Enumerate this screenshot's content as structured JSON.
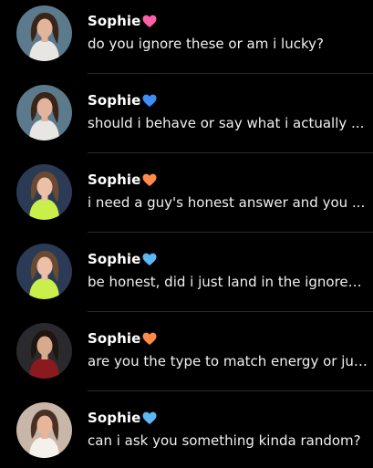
{
  "conversations": [
    {
      "name": "Sophie",
      "heart": "pink-heart-icon",
      "heart_color": "#ff5fa8",
      "preview": "do you ignore these or am i lucky?",
      "avatar_bg": "#5b7a8c",
      "hair": "#3a2418",
      "skin": "#e3b49c",
      "top": "#e8e6e2"
    },
    {
      "name": "Sophie",
      "heart": "blue-heart-icon",
      "heart_color": "#3d8ef7",
      "preview": "should i behave or say what i actually ...",
      "avatar_bg": "#5b7a8c",
      "hair": "#3a2418",
      "skin": "#e3b49c",
      "top": "#e8e6e2"
    },
    {
      "name": "Sophie",
      "heart": "orange-heart-icon",
      "heart_color": "#ff8a4c",
      "preview": "i need a guy's honest answer and you ...",
      "avatar_bg": "#2b3a55",
      "hair": "#6a4a30",
      "skin": "#eac0a6",
      "top": "#c9ef4a"
    },
    {
      "name": "Sophie",
      "heart": "light-blue-heart-icon",
      "heart_color": "#5cb8f5",
      "preview": "be honest, did i just land in the ignored ...",
      "avatar_bg": "#2b3a55",
      "hair": "#6a4a30",
      "skin": "#eac0a6",
      "top": "#c9ef4a"
    },
    {
      "name": "Sophie",
      "heart": "orange-heart-icon",
      "heart_color": "#ff8a4c",
      "preview": "are you the type to match energy or jus...",
      "avatar_bg": "#2a2a2e",
      "hair": "#1e1612",
      "skin": "#d9a98c",
      "top": "#8a1a1f"
    },
    {
      "name": "Sophie",
      "heart": "light-blue-heart-icon",
      "heart_color": "#5cb8f5",
      "preview": "can i ask you something kinda random?",
      "avatar_bg": "#c8b7a8",
      "hair": "#4a3024",
      "skin": "#e7b69a",
      "top": "#f4f0ea"
    }
  ]
}
